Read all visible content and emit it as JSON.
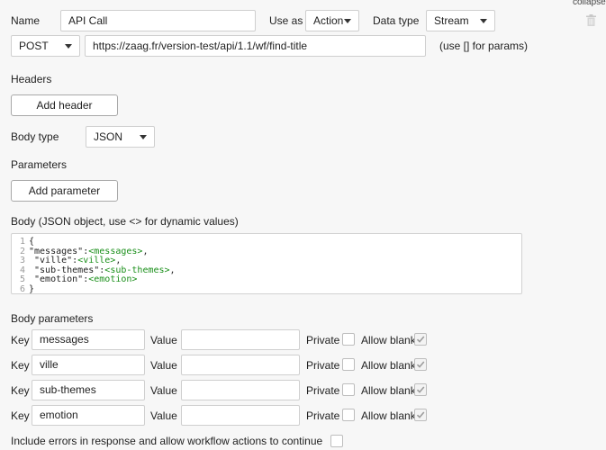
{
  "top_right": {
    "collapse_label": "collapse"
  },
  "row1": {
    "name_label": "Name",
    "name_value": "API Call",
    "use_as_label": "Use as",
    "use_as_value": "Action",
    "data_type_label": "Data type",
    "data_type_value": "Stream"
  },
  "row2": {
    "method_value": "POST",
    "url_value": "https://zaag.fr/version-test/api/1.1/wf/find-title",
    "params_hint": "(use [] for params)"
  },
  "headers": {
    "title": "Headers",
    "add_button": "Add header"
  },
  "body_type": {
    "label": "Body type",
    "value": "JSON"
  },
  "parameters": {
    "title": "Parameters",
    "add_button": "Add parameter"
  },
  "body": {
    "label": "Body (JSON object, use <> for dynamic values)",
    "line_numbers": [
      "1",
      "2",
      "3",
      "4",
      "5",
      "6"
    ],
    "lines": [
      [
        {
          "t": "{",
          "c": "plain"
        }
      ],
      [
        {
          "t": "\"messages\":",
          "c": "plain"
        },
        {
          "t": "<messages>",
          "c": "tok"
        },
        {
          "t": ",",
          "c": "plain"
        }
      ],
      [
        {
          "t": " \"ville\":",
          "c": "plain"
        },
        {
          "t": "<ville>",
          "c": "tok"
        },
        {
          "t": ",",
          "c": "plain"
        }
      ],
      [
        {
          "t": " \"sub-themes\":",
          "c": "plain"
        },
        {
          "t": "<sub-themes>",
          "c": "tok"
        },
        {
          "t": ",",
          "c": "plain"
        }
      ],
      [
        {
          "t": " \"emotion\":",
          "c": "plain"
        },
        {
          "t": "<emotion>",
          "c": "tok"
        }
      ],
      [
        {
          "t": "}",
          "c": "plain"
        }
      ]
    ]
  },
  "body_parameters": {
    "title": "Body parameters",
    "key_label": "Key",
    "value_label": "Value",
    "private_label": "Private",
    "allow_blank_label": "Allow blank",
    "rows": [
      {
        "key": "messages",
        "value": "",
        "private": false,
        "allow_blank": true
      },
      {
        "key": "ville",
        "value": "",
        "private": false,
        "allow_blank": true
      },
      {
        "key": "sub-themes",
        "value": "",
        "private": false,
        "allow_blank": true
      },
      {
        "key": "emotion",
        "value": "",
        "private": false,
        "allow_blank": true
      }
    ]
  },
  "footer": {
    "include_errors_label": "Include errors in response and allow workflow actions to continue",
    "include_errors_checked": false
  },
  "colors": {
    "background": "#f7f7f7",
    "code_token": "#1a8f1a"
  },
  "icons": {
    "delete": "trash-icon"
  }
}
